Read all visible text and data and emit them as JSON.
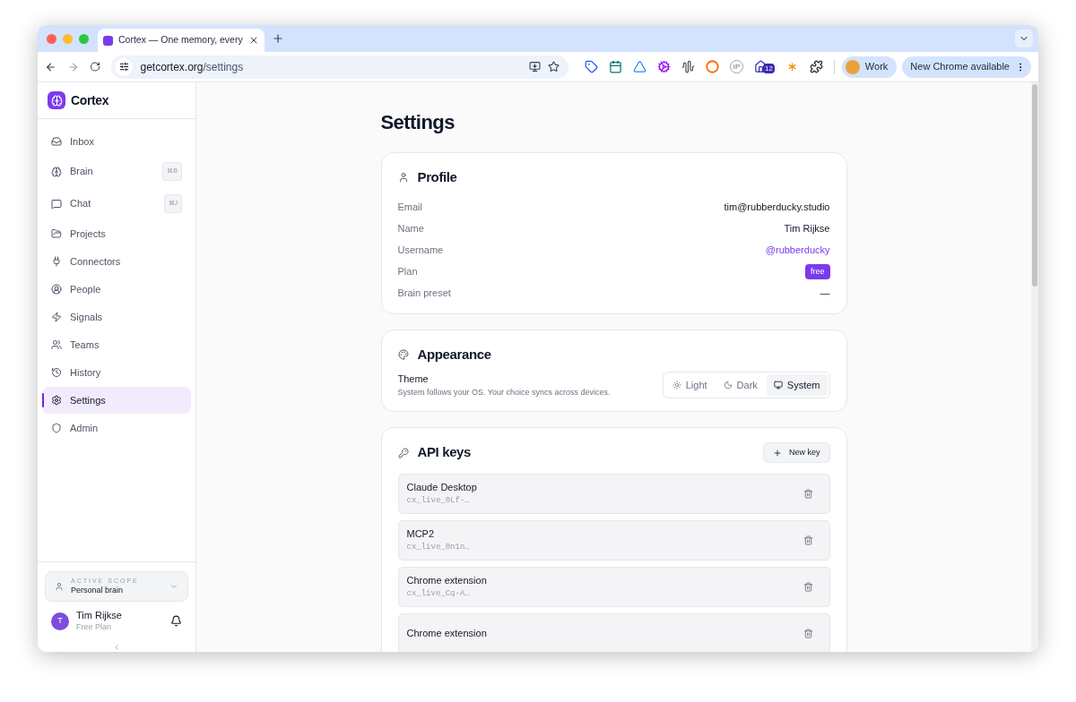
{
  "browser": {
    "tab": {
      "title": "Cortex — One memory, every"
    },
    "url": {
      "host": "getcortex.org",
      "path": "/settings"
    },
    "extensions": [
      {
        "kind": "tag"
      },
      {
        "kind": "calendar"
      },
      {
        "kind": "triangle"
      },
      {
        "kind": "gear"
      },
      {
        "kind": "wave"
      },
      {
        "kind": "ring"
      },
      {
        "kind": "ip",
        "label": "IP"
      },
      {
        "kind": "badge",
        "badge": "12"
      },
      {
        "kind": "spark"
      },
      {
        "kind": "puzzle"
      }
    ],
    "profile": {
      "label": "Work"
    },
    "update": {
      "label": "New Chrome available"
    }
  },
  "app": {
    "name": "Cortex"
  },
  "sidebar": {
    "items": [
      {
        "label": "Inbox",
        "selected": false
      },
      {
        "label": "Brain",
        "shortcut": "⌘B",
        "selected": false
      },
      {
        "label": "Chat",
        "shortcut": "⌘J",
        "selected": false
      },
      {
        "label": "Projects",
        "selected": false
      },
      {
        "label": "Connectors",
        "selected": false
      },
      {
        "label": "People",
        "selected": false
      },
      {
        "label": "Signals",
        "selected": false
      },
      {
        "label": "Teams",
        "selected": false
      },
      {
        "label": "History",
        "selected": false
      },
      {
        "label": "Settings",
        "selected": true
      },
      {
        "label": "Admin",
        "selected": false
      }
    ],
    "scope": {
      "caption": "ACTIVE SCOPE",
      "value": "Personal brain"
    },
    "user": {
      "initial": "T",
      "name": "Tim Rijkse",
      "plan": "Free Plan"
    }
  },
  "page": {
    "title": "Settings",
    "profile": {
      "title": "Profile",
      "rows": [
        {
          "label": "Email",
          "value": "tim@rubberducky.studio",
          "kind": "text"
        },
        {
          "label": "Name",
          "value": "Tim Rijkse",
          "kind": "text"
        },
        {
          "label": "Username",
          "value": "@rubberducky",
          "kind": "link"
        },
        {
          "label": "Plan",
          "value": "free",
          "kind": "badge"
        },
        {
          "label": "Brain preset",
          "value": "—",
          "kind": "text"
        }
      ]
    },
    "appearance": {
      "title": "Appearance",
      "theme": {
        "label": "Theme",
        "hint": "System follows your OS. Your choice syncs across devices.",
        "options": [
          {
            "label": "Light",
            "selected": false
          },
          {
            "label": "Dark",
            "selected": false
          },
          {
            "label": "System",
            "selected": true
          }
        ]
      }
    },
    "api_keys": {
      "title": "API keys",
      "button": "New key",
      "keys": [
        {
          "name": "Claude Desktop",
          "key": "cx_live_0Lf-…"
        },
        {
          "name": "MCP2",
          "key": "cx_live_0n1n…"
        },
        {
          "name": "Chrome extension",
          "key": "cx_live_Cq-A…"
        },
        {
          "name": "Chrome extension"
        }
      ]
    }
  }
}
